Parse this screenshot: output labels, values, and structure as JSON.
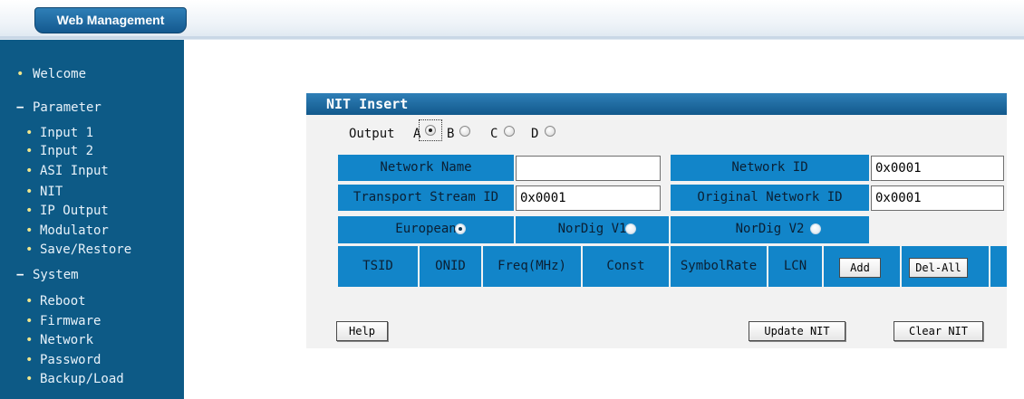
{
  "header": {
    "brand": "Web Management"
  },
  "sidebar": {
    "welcome": "Welcome",
    "parameter": "Parameter",
    "parameter_items": [
      "Input 1",
      "Input 2",
      "ASI Input",
      "NIT",
      "IP Output",
      "Modulator",
      "Save/Restore"
    ],
    "system": "System",
    "system_items": [
      "Reboot",
      "Firmware",
      "Network",
      "Password",
      "Backup/Load"
    ]
  },
  "panel": {
    "title": "NIT Insert",
    "output_label": "Output",
    "outputs": [
      {
        "label": "A",
        "selected": true
      },
      {
        "label": "B",
        "selected": false
      },
      {
        "label": "C",
        "selected": false
      },
      {
        "label": "D",
        "selected": false
      }
    ],
    "fields": {
      "network_name_label": "Network Name",
      "network_name_value": "",
      "network_id_label": "Network ID",
      "network_id_value": "0x0001",
      "ts_id_label": "Transport Stream ID",
      "ts_id_value": "0x0001",
      "onid_label": "Original Network ID",
      "onid_value": "0x0001"
    },
    "modes": [
      {
        "label": "European",
        "selected": true
      },
      {
        "label": "NorDig V1",
        "selected": false
      },
      {
        "label": "NorDig V2",
        "selected": false
      }
    ],
    "columns": [
      "TSID",
      "ONID",
      "Freq(MHz)",
      "Const",
      "SymbolRate",
      "LCN"
    ],
    "add_label": "Add",
    "del_all_label": "Del-All",
    "help_label": "Help",
    "update_label": "Update NIT",
    "clear_label": "Clear NIT"
  },
  "colors": {
    "sidebar": "#0d5a86",
    "accent": "#1285c9",
    "panel_bg": "#f2f2f2"
  }
}
